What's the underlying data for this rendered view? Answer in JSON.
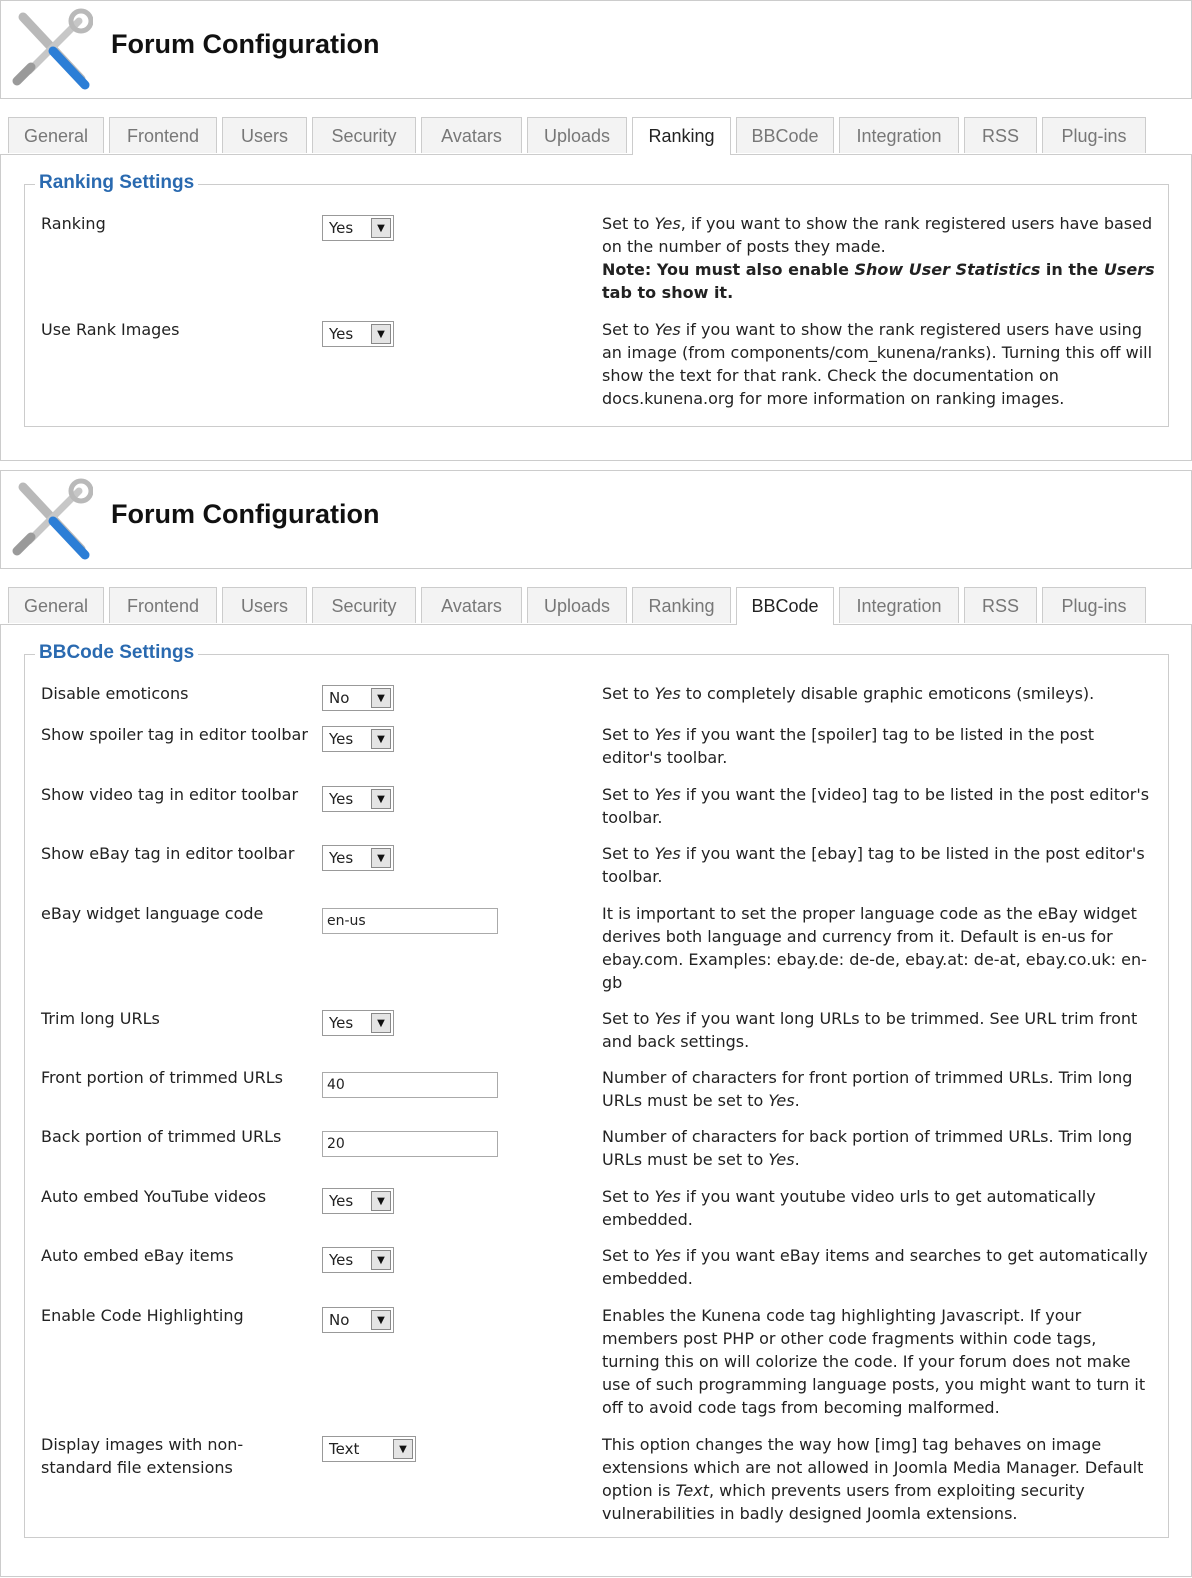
{
  "page_title": "Forum Configuration",
  "tabs": [
    "General",
    "Frontend",
    "Users",
    "Security",
    "Avatars",
    "Uploads",
    "Ranking",
    "BBCode",
    "Integration",
    "RSS",
    "Plug-ins"
  ],
  "ranking": {
    "active_tab": "Ranking",
    "legend": "Ranking Settings",
    "rows": [
      {
        "label": "Ranking",
        "value": "Yes",
        "desc_parts": [
          "Set to ",
          "Yes",
          ", if you want to show the rank registered users have based on the number of posts they made."
        ],
        "note_parts": [
          "Note: You must also enable ",
          "Show User Statistics",
          " in the ",
          "Users",
          " tab to show it."
        ]
      },
      {
        "label": "Use Rank Images",
        "value": "Yes",
        "desc_parts": [
          "Set to ",
          "Yes",
          " if you want to show the rank registered users have using an image (from components/com_kunena/ranks). Turning this off will show the text for that rank. Check the documentation on docs.kunena.org for more information on ranking images."
        ]
      }
    ]
  },
  "bbcode": {
    "active_tab": "BBCode",
    "legend": "BBCode Settings",
    "rows": [
      {
        "label": "Disable emoticons",
        "type": "select",
        "value": "No",
        "desc_parts": [
          "Set to ",
          "Yes",
          " to completely disable graphic emoticons (smileys)."
        ]
      },
      {
        "label": "Show spoiler tag in editor toolbar",
        "type": "select",
        "value": "Yes",
        "desc_parts": [
          "Set to ",
          "Yes",
          " if you want the [spoiler] tag to be listed in the post editor's toolbar."
        ]
      },
      {
        "label": "Show video tag in editor toolbar",
        "type": "select",
        "value": "Yes",
        "desc_parts": [
          "Set to ",
          "Yes",
          " if you want the [video] tag to be listed in the post editor's toolbar."
        ]
      },
      {
        "label": "Show eBay tag in editor toolbar",
        "type": "select",
        "value": "Yes",
        "desc_parts": [
          "Set to ",
          "Yes",
          " if you want the [ebay] tag to be listed in the post editor's toolbar."
        ]
      },
      {
        "label": "eBay widget language code",
        "type": "text",
        "value": "en-us",
        "desc_parts": [
          "It is important to set the proper language code as the eBay widget derives both language and currency from it. Default is en-us for ebay.com. Examples: ebay.de: de-de, ebay.at: de-at, ebay.co.uk: en-gb"
        ]
      },
      {
        "label": "Trim long URLs",
        "type": "select",
        "value": "Yes",
        "desc_parts": [
          "Set to ",
          "Yes",
          " if you want long URLs to be trimmed. See URL trim front and back settings."
        ]
      },
      {
        "label": "Front portion of trimmed URLs",
        "type": "text",
        "value": "40",
        "desc_parts": [
          "Number of characters for front portion of trimmed URLs. Trim long URLs must be set to ",
          "Yes",
          "."
        ]
      },
      {
        "label": "Back portion of trimmed URLs",
        "type": "text",
        "value": "20",
        "desc_parts": [
          "Number of characters for back portion of trimmed URLs. Trim long URLs must be set to ",
          "Yes",
          "."
        ]
      },
      {
        "label": "Auto embed YouTube videos",
        "type": "select",
        "value": "Yes",
        "desc_parts": [
          "Set to ",
          "Yes",
          " if you want youtube video urls to get automatically embedded."
        ]
      },
      {
        "label": "Auto embed eBay items",
        "type": "select",
        "value": "Yes",
        "desc_parts": [
          "Set to ",
          "Yes",
          " if you want eBay items and searches to get automatically embedded."
        ]
      },
      {
        "label": "Enable Code Highlighting",
        "type": "select",
        "value": "No",
        "desc_parts": [
          "Enables the Kunena code tag highlighting Javascript. If your members post PHP or other code fragments within code tags, turning this on will colorize the code. If your forum does not make use of such programming language posts, you might want to turn it off to avoid code tags from becoming malformed."
        ]
      },
      {
        "label": "Display images with non-standard file extensions",
        "type": "select",
        "value": "Text",
        "wide": true,
        "desc_parts": [
          "This option changes the way how [img] tag behaves on image extensions which are not allowed in Joomla Media Manager. Default option is ",
          "Text",
          ", which prevents users from exploiting security vulnerabilities in badly designed Joomla extensions."
        ]
      }
    ]
  }
}
